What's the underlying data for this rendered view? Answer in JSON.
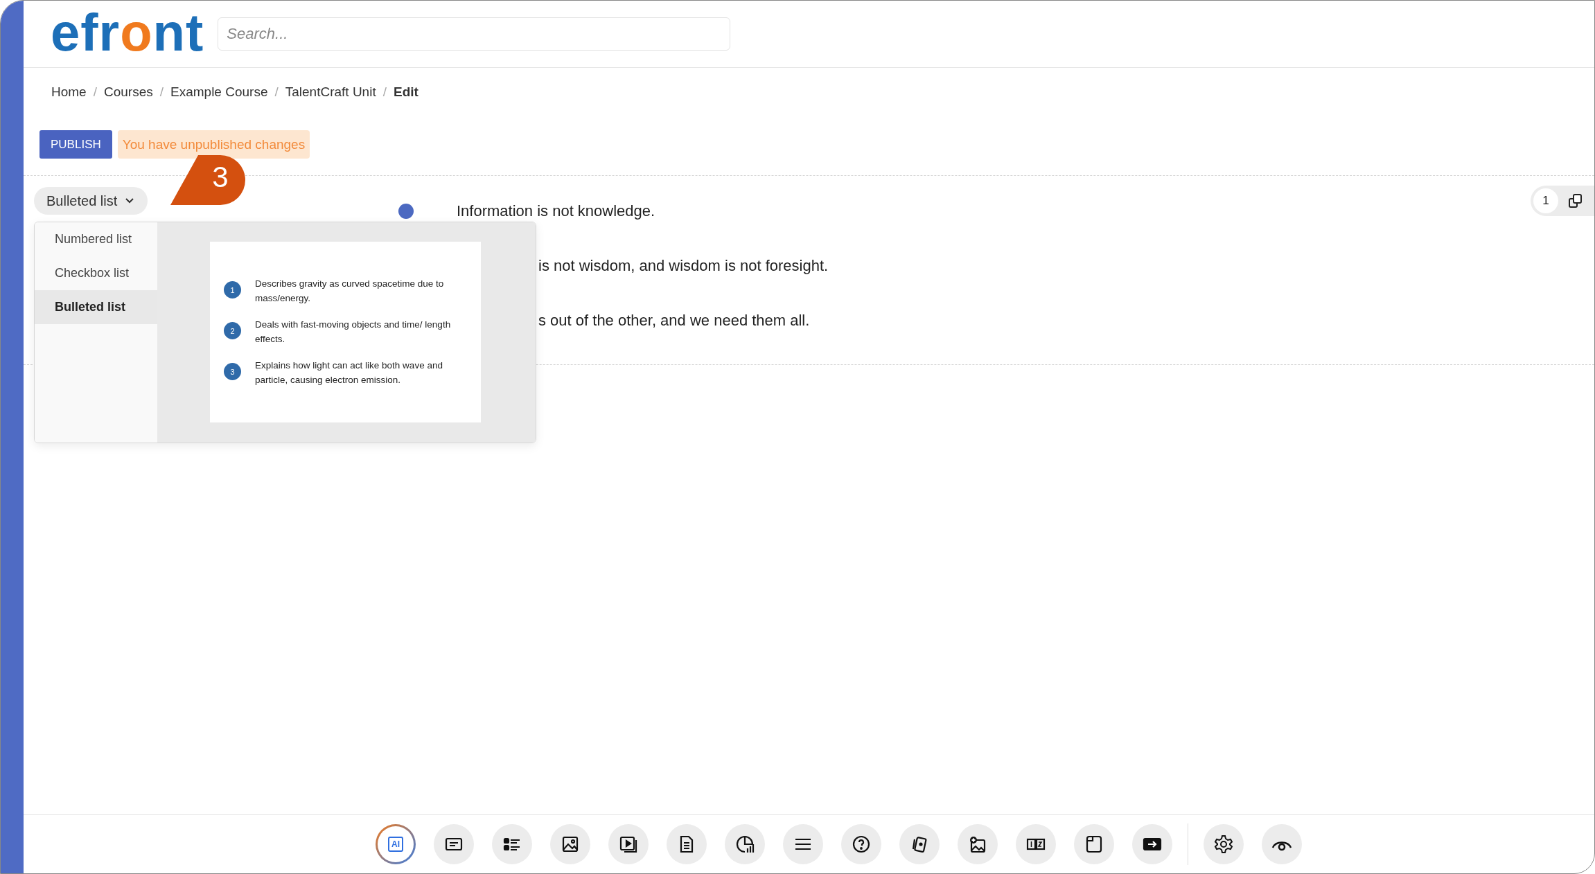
{
  "header": {
    "logo": "efront",
    "search": {
      "placeholder": "Search..."
    }
  },
  "breadcrumbs": {
    "separator": "/",
    "items": [
      {
        "label": "Home",
        "current": false
      },
      {
        "label": "Courses",
        "current": false
      },
      {
        "label": "Example Course",
        "current": false
      },
      {
        "label": "TalentCraft Unit",
        "current": false
      },
      {
        "label": "Edit",
        "current": true
      }
    ]
  },
  "publish_button": "PUBLISH",
  "status_badge": "You have unpublished changes",
  "callout": "3",
  "list_type_button": "Bulleted list",
  "list_type_menu": {
    "options": [
      {
        "label": "Numbered list",
        "selected": false
      },
      {
        "label": "Checkbox list",
        "selected": false
      },
      {
        "label": "Bulleted list",
        "selected": true
      }
    ],
    "preview": [
      {
        "number": "1",
        "text": "Describes gravity as curved spacetime due to mass/energy."
      },
      {
        "number": "2",
        "text": "Deals with fast-moving objects and time/ length effects."
      },
      {
        "number": "3",
        "text": "Explains how light can act like both wave and particle, causing electron emission."
      }
    ]
  },
  "list_items": [
    {
      "text": "Information is not knowledge.",
      "covered": false
    },
    {
      "text": "is not wisdom, and wisdom is not foresight.",
      "covered": true
    },
    {
      "text": "s out of the other, and we need them all.",
      "covered": true
    }
  ],
  "block_counter": "1",
  "toolbar": {
    "ai_label": "AI"
  }
}
